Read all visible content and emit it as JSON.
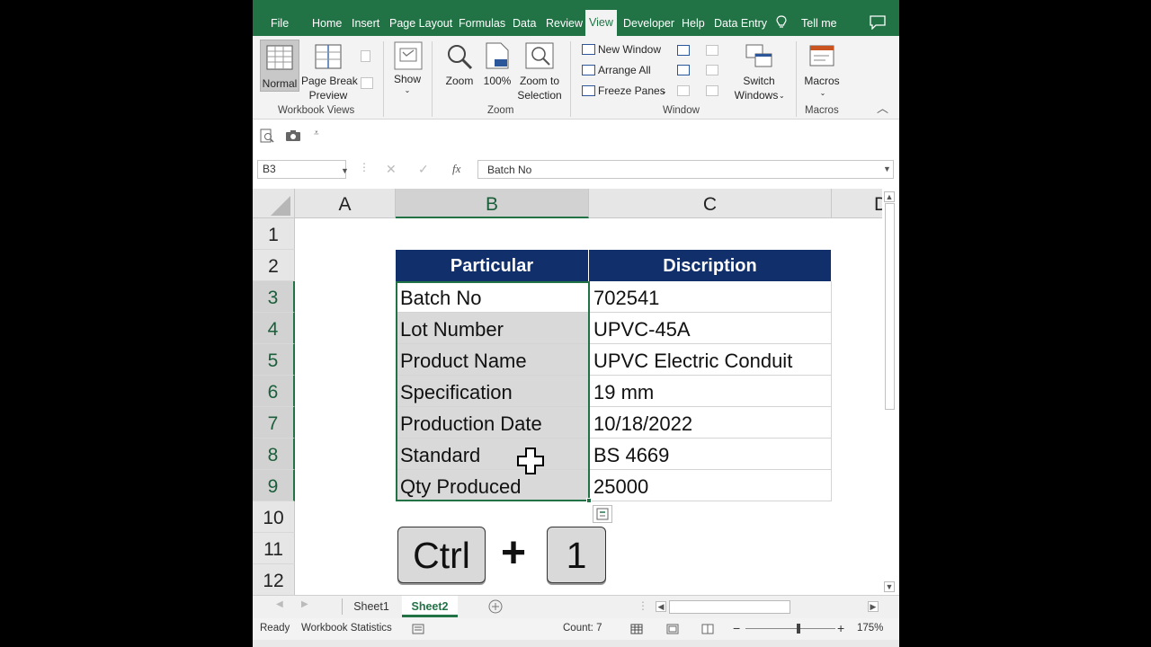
{
  "tabs": [
    "File",
    "Home",
    "Insert",
    "Page Layout",
    "Formulas",
    "Data",
    "Review",
    "View",
    "Developer",
    "Help",
    "Data Entry",
    "Tell me"
  ],
  "active_tab": "View",
  "ribbon": {
    "workbook_views": {
      "normal": "Normal",
      "page_break_1": "Page Break",
      "page_break_2": "Preview",
      "group_label": "Workbook Views"
    },
    "show": {
      "label": "Show"
    },
    "zoom": {
      "zoom": "Zoom",
      "hundred": "100%",
      "zoom_sel_1": "Zoom to",
      "zoom_sel_2": "Selection",
      "group_label": "Zoom"
    },
    "window": {
      "new_window": "New Window",
      "arrange_all": "Arrange All",
      "freeze_panes": "Freeze Panes",
      "switch_1": "Switch",
      "switch_2": "Windows",
      "group_label": "Window"
    },
    "macros": {
      "label": "Macros",
      "group_label": "Macros"
    }
  },
  "formula_bar": {
    "name_box": "B3",
    "fx": "fx",
    "content": "Batch No"
  },
  "columns": [
    "A",
    "B",
    "C",
    "D"
  ],
  "rows": [
    "1",
    "2",
    "3",
    "4",
    "5",
    "6",
    "7",
    "8",
    "9",
    "10",
    "11",
    "12"
  ],
  "table": {
    "header": [
      "Particular",
      "Discription"
    ],
    "rows": [
      [
        "Batch No",
        "702541"
      ],
      [
        "Lot Number",
        "UPVC-45A"
      ],
      [
        "Product Name",
        "UPVC Electric Conduit"
      ],
      [
        "Specification",
        "19 mm"
      ],
      [
        "Production Date",
        "10/18/2022"
      ],
      [
        "Standard",
        "BS 4669"
      ],
      [
        "Qty Produced",
        "25000"
      ]
    ]
  },
  "keys": {
    "ctrl": "Ctrl",
    "plus": "+",
    "one": "1"
  },
  "sheets": [
    "Sheet1",
    "Sheet2"
  ],
  "active_sheet": "Sheet2",
  "status": {
    "ready": "Ready",
    "workbook_stats": "Workbook Statistics",
    "count": "Count: 7",
    "zoom": "175%",
    "minus": "−",
    "plus": "+"
  },
  "colors": {
    "excel_green": "#217346",
    "table_header": "#102f6b",
    "selection_fill": "#d9d9d9"
  }
}
